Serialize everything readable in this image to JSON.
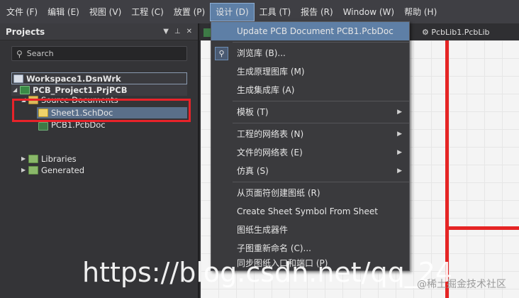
{
  "menubar": {
    "items": [
      "文件 (F)",
      "编辑 (E)",
      "视图 (V)",
      "工程 (C)",
      "放置 (P)",
      "设计 (D)",
      "工具 (T)",
      "报告 (R)",
      "Window (W)",
      "帮助 (H)"
    ]
  },
  "projects": {
    "title": "Projects",
    "search_placeholder": "Search",
    "tree": {
      "workspace": "Workspace1.DsnWrk",
      "project": "PCB_Project1.PrjPCB",
      "source_documents": "Source Documents",
      "sheet": "Sheet1.SchDoc",
      "pcb": "PCB1.PcbDoc",
      "libraries": "Libraries",
      "generated": "Generated"
    }
  },
  "doc_tabs": {
    "pcblib": "PcbLib1.PcbLib"
  },
  "design_menu": {
    "items": [
      "Update PCB Document PCB1.PcbDoc",
      "浏览库 (B)...",
      "生成原理图库 (M)",
      "生成集成库 (A)",
      "模板 (T)",
      "工程的网络表 (N)",
      "文件的网络表 (E)",
      "仿真 (S)",
      "从页面符创建图纸 (R)",
      "Create Sheet Symbol From Sheet",
      "图纸生成器件",
      "子图重新命名 (C)...",
      "同步图纸入口和端口 (P)"
    ]
  },
  "watermark": {
    "url": "https://blog.csdn.net/qq_24",
    "site": "@稀土掘金技术社区"
  },
  "colors": {
    "highlight": "#5e7fa6",
    "annotation_red": "#e8232a"
  }
}
